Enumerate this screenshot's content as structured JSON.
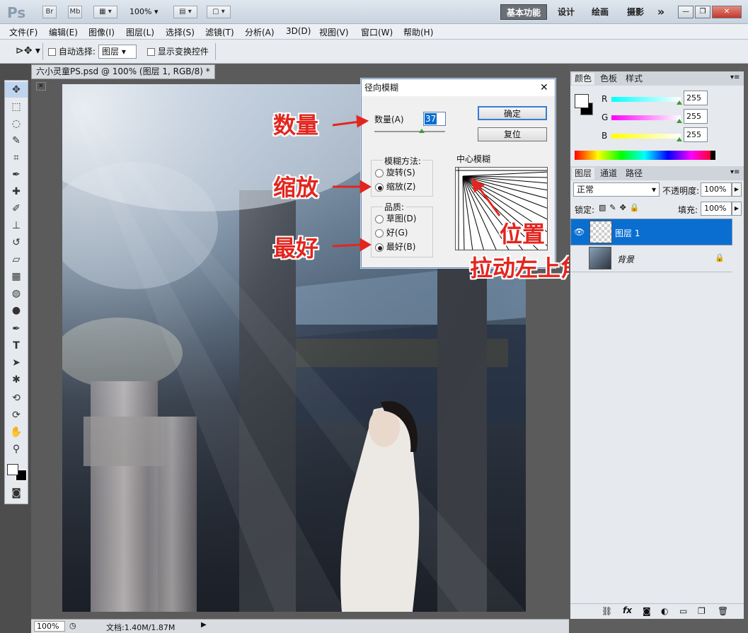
{
  "app": {
    "logo": "Ps",
    "br": "Br",
    "mb": "Mb",
    "zoom": "100%"
  },
  "workspaces": [
    "基本功能",
    "设计",
    "绘画",
    "摄影"
  ],
  "more": "»",
  "menu": [
    "文件(F)",
    "编辑(E)",
    "图像(I)",
    "图层(L)",
    "选择(S)",
    "滤镜(T)",
    "分析(A)",
    "3D(D)",
    "视图(V)",
    "窗口(W)",
    "帮助(H)"
  ],
  "options": {
    "auto_select_label": "自动选择:",
    "auto_select_value": "图层",
    "show_transform_label": "显示变换控件"
  },
  "document_tab": "六小灵童PS.psd @ 100% (图层 1, RGB/8) *",
  "dialog": {
    "title": "径向模糊",
    "amount_label": "数量(A)",
    "amount_value": "37",
    "ok": "确定",
    "reset": "复位",
    "method_label": "模糊方法:",
    "method_options": [
      "旋转(S)",
      "缩放(Z)"
    ],
    "method_selected": 1,
    "quality_label": "品质:",
    "quality_options": [
      "草图(D)",
      "好(G)",
      "最好(B)"
    ],
    "quality_selected": 2,
    "center_label": "中心模糊"
  },
  "annotations": {
    "amount": "数量",
    "zoom": "缩放",
    "best": "最好",
    "position": "位置",
    "drag": "拉动左上角"
  },
  "color_panel": {
    "tabs": [
      "颜色",
      "色板",
      "样式"
    ],
    "channels": [
      {
        "name": "R",
        "value": "255"
      },
      {
        "name": "G",
        "value": "255"
      },
      {
        "name": "B",
        "value": "255"
      }
    ]
  },
  "layers_panel": {
    "tabs": [
      "图层",
      "通道",
      "路径"
    ],
    "blend_mode": "正常",
    "opacity_label": "不透明度:",
    "opacity_value": "100%",
    "lock_label": "锁定:",
    "fill_label": "填充:",
    "fill_value": "100%",
    "layers": [
      {
        "name": "图层 1",
        "selected": true
      },
      {
        "name": "背景",
        "selected": false
      }
    ]
  },
  "status": {
    "zoom": "100%",
    "doc": "文档:1.40M/1.87M"
  },
  "colors": {
    "accent": "#0a6ed1",
    "annotation": "#e2261f"
  }
}
